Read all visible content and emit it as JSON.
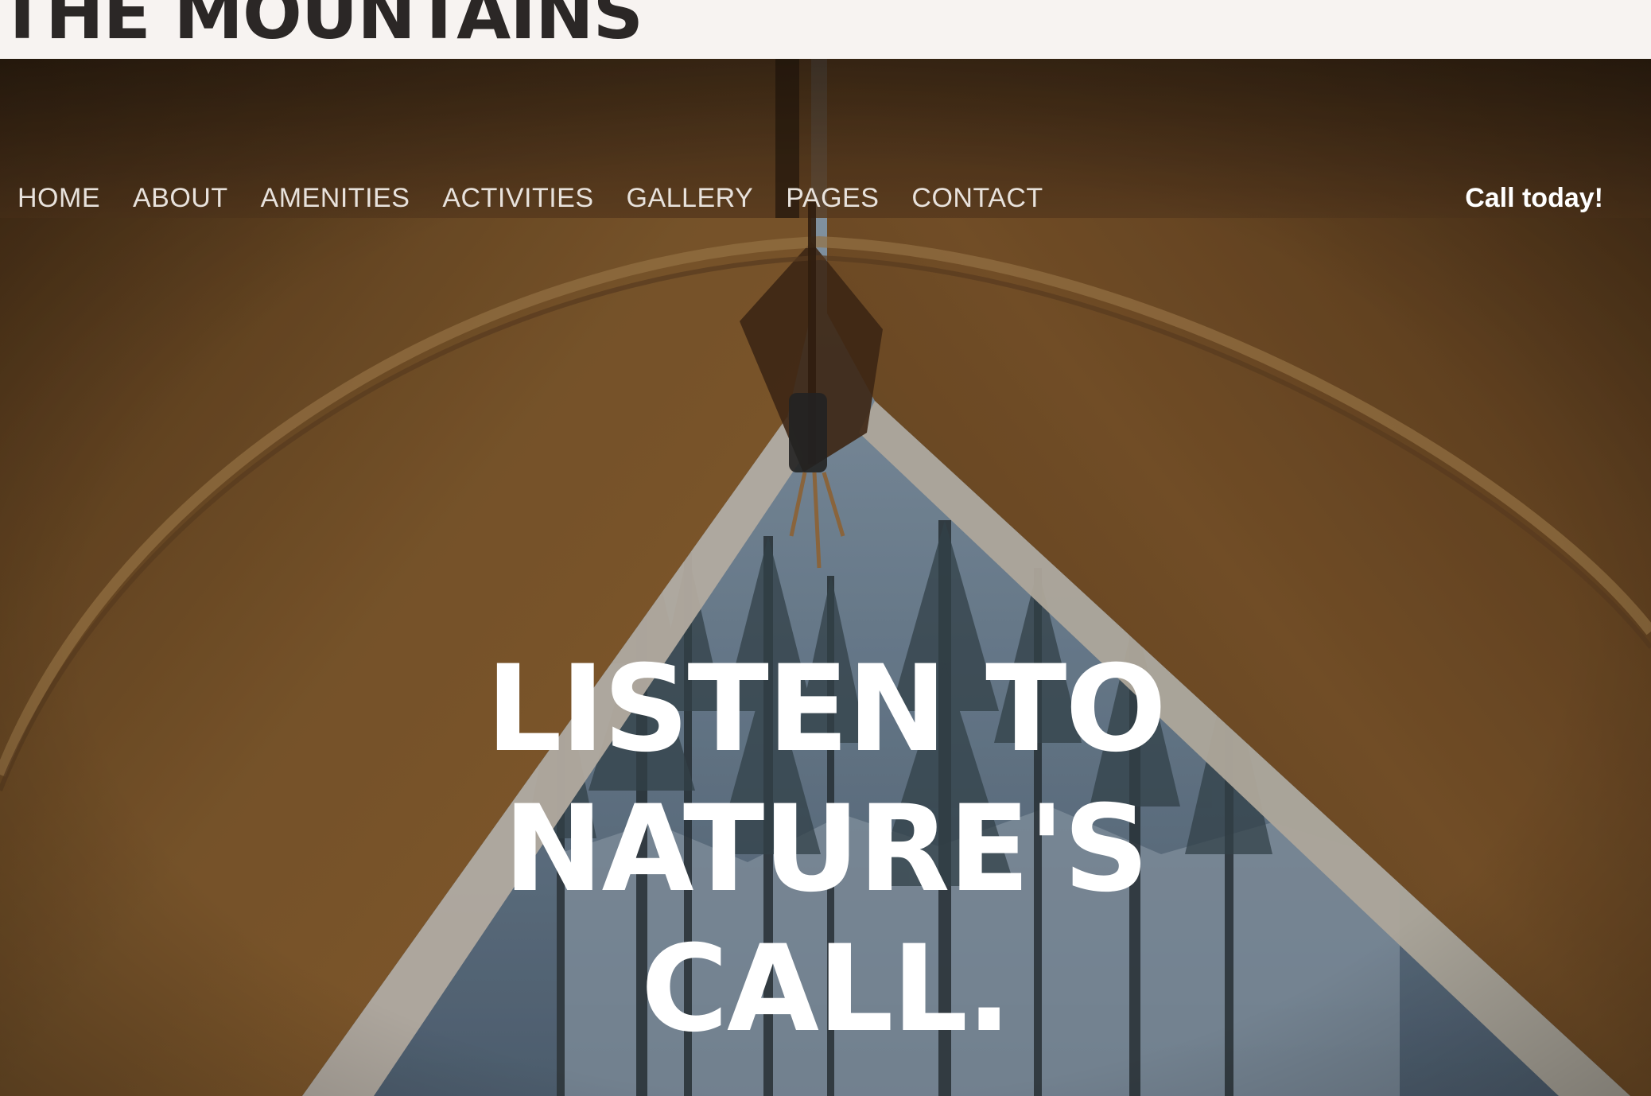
{
  "site": {
    "logo_text": "THE MOUNTAINS"
  },
  "nav": {
    "items": [
      {
        "label": "HOME"
      },
      {
        "label": "ABOUT"
      },
      {
        "label": "AMENITIES"
      },
      {
        "label": "ACTIVITIES"
      },
      {
        "label": "GALLERY"
      },
      {
        "label": "PAGES"
      },
      {
        "label": "CONTACT"
      }
    ],
    "cta_label": "Call today!"
  },
  "hero": {
    "headline_lines": [
      "LISTEN TO",
      "NATURE'S",
      "CALL."
    ]
  },
  "colors": {
    "header_bg": "#f7f3f1",
    "logo": "#2b2726",
    "canvas_tan": "#8a5d2e",
    "canvas_edge": "#cfc6b8",
    "forest_sky": "#8ea4b8",
    "headline": "#ffffff"
  }
}
